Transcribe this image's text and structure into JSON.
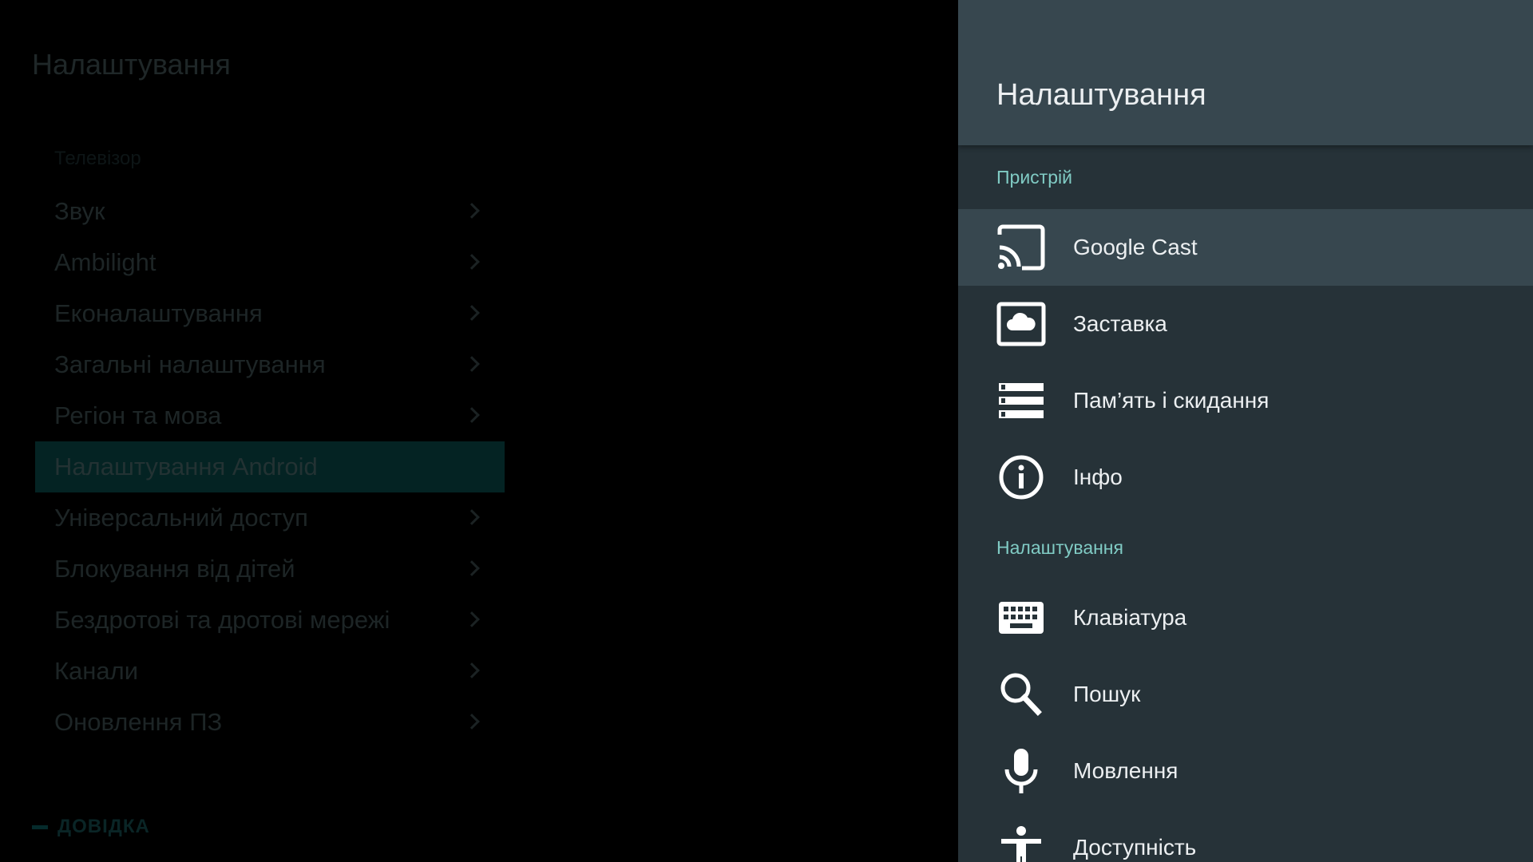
{
  "background": {
    "title": "Налаштування",
    "subheader": "Телевізор",
    "items": [
      {
        "label": "Звук",
        "chevron": true
      },
      {
        "label": "Ambilight",
        "chevron": true
      },
      {
        "label": "Еконалаштування",
        "chevron": true
      },
      {
        "label": "Загальні налаштування",
        "chevron": true
      },
      {
        "label": "Регіон та мова",
        "chevron": true
      },
      {
        "label": "Налаштування Android",
        "chevron": false,
        "active": true
      },
      {
        "label": "Універсальний доступ",
        "chevron": true
      },
      {
        "label": "Блокування від дітей",
        "chevron": true
      },
      {
        "label": "Бездротові та дротові мережі",
        "chevron": true
      },
      {
        "label": "Канали",
        "chevron": true
      },
      {
        "label": "Оновлення ПЗ",
        "chevron": true
      }
    ],
    "help": "ДОВІДКА"
  },
  "panel": {
    "title": "Налаштування",
    "sections": {
      "device": "Пристрій",
      "preferences": "Налаштування"
    },
    "items": {
      "cast": {
        "label": "Google Cast",
        "icon": "cast-icon"
      },
      "screensaver": {
        "label": "Заставка",
        "icon": "screensaver-icon"
      },
      "storage": {
        "label": "Пам’ять і скидання",
        "icon": "storage-icon"
      },
      "about": {
        "label": "Інфо",
        "icon": "info-icon"
      },
      "keyboard": {
        "label": "Клавіатура",
        "icon": "keyboard-icon"
      },
      "search": {
        "label": "Пошук",
        "icon": "search-icon"
      },
      "speech": {
        "label": "Мовлення",
        "icon": "microphone-icon"
      },
      "accessibility": {
        "label": "Доступність",
        "icon": "accessibility-icon"
      }
    }
  },
  "colors": {
    "panel_bg": "#263238",
    "header_bg": "#37474f",
    "section_text": "#80cbc4",
    "item_text": "#eceff1"
  }
}
